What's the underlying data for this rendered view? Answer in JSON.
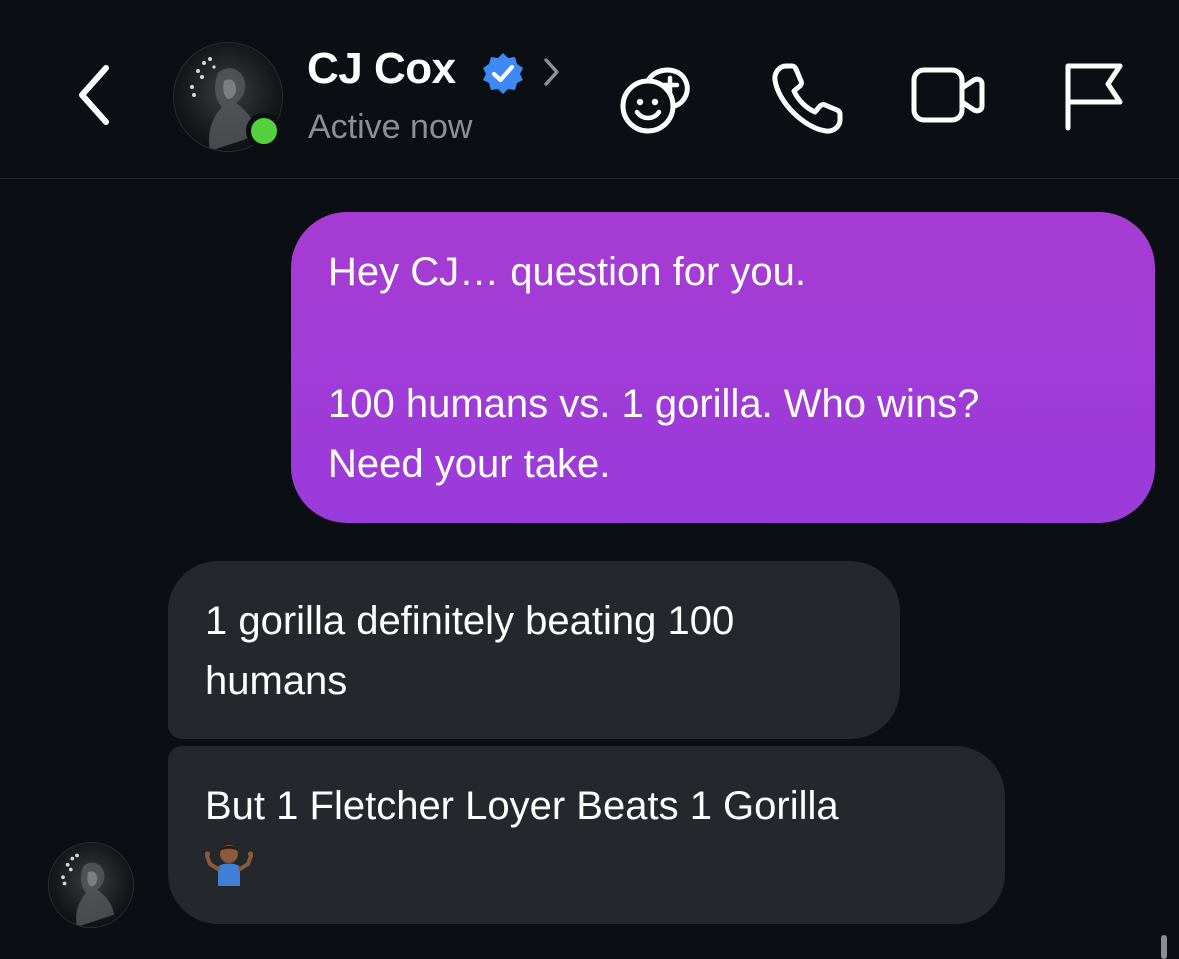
{
  "header": {
    "back_icon": "chevron-left-icon",
    "contact_name": "CJ Cox",
    "verified_icon": "verified-badge-icon",
    "chevron_icon": "chevron-right-icon",
    "status": "Active now",
    "online_color": "#55d13d",
    "actions": [
      {
        "name": "add-effects-icon"
      },
      {
        "name": "phone-icon"
      },
      {
        "name": "video-icon"
      },
      {
        "name": "flag-icon"
      }
    ]
  },
  "messages": [
    {
      "direction": "outgoing",
      "paragraphs": [
        [
          "Hey CJ… question for you."
        ],
        [
          "100 humans vs. 1 gorilla. Who wins?",
          "Need your take."
        ]
      ]
    },
    {
      "direction": "incoming",
      "lines": [
        "1 gorilla definitely beating 100",
        "humans"
      ]
    },
    {
      "direction": "incoming",
      "lines": [
        "But 1 Fletcher Loyer Beats 1 Gorilla"
      ],
      "emoji": "person-shrugging-emoji"
    }
  ],
  "colors": {
    "background": "#0b0f13",
    "outgoing_bubble": "#a63cd3",
    "incoming_bubble": "#24272b",
    "verified": "#3d8af7",
    "status_text": "#8b9098"
  }
}
